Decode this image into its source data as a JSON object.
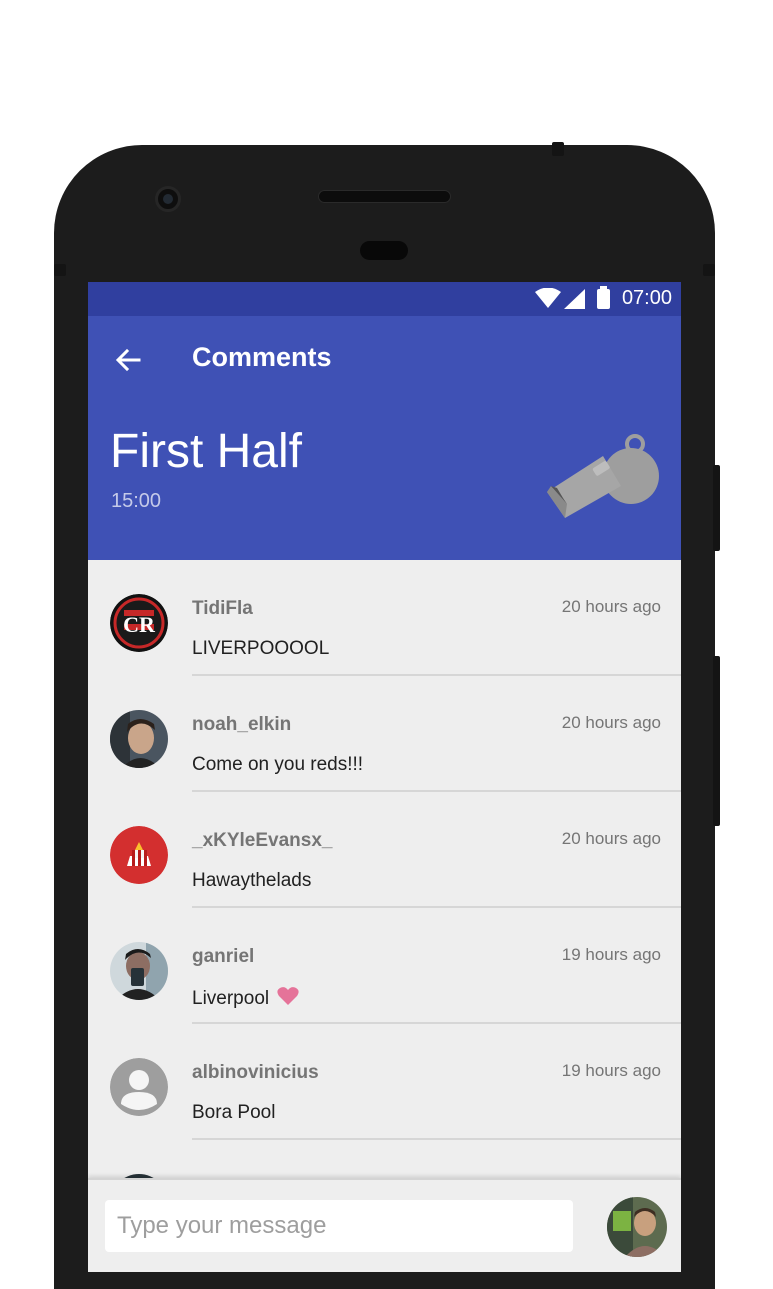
{
  "status_bar": {
    "time": "07:00"
  },
  "header": {
    "back_icon": "arrow-left-icon",
    "title": "Comments",
    "period_title": "First Half",
    "period_time": "15:00",
    "whistle_icon": "whistle-icon",
    "color": "#3f51b5"
  },
  "comments": [
    {
      "user": "TidiFla",
      "time": "20 hours ago",
      "text": "LIVERPOOOOL"
    },
    {
      "user": "noah_elkin",
      "time": "20 hours ago",
      "text": "Come on you reds!!!"
    },
    {
      "user": "_xKYleEvansx_",
      "time": "20 hours ago",
      "text": "Hawaythelads"
    },
    {
      "user": "ganriel",
      "time": "19 hours ago",
      "text": "Liverpool",
      "emoji": "heart-icon"
    },
    {
      "user": "albinovinicius",
      "time": "19 hours ago",
      "text": "Bora Pool"
    }
  ],
  "composer": {
    "placeholder": "Type your message",
    "value": ""
  }
}
